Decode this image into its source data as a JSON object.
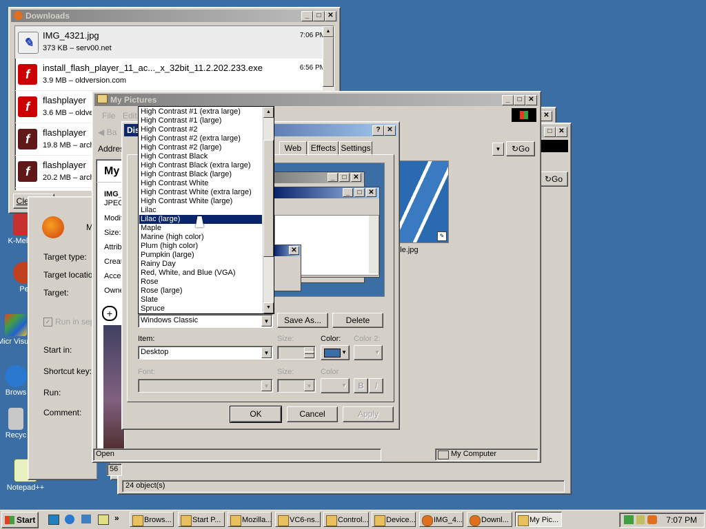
{
  "colors": {
    "desktop": "#3a6ea5",
    "titlebar_active": "#0a246a",
    "selection": "#0a246a",
    "window_face": "#d4d0c8"
  },
  "desktop_icons": [
    {
      "label": "K-Meleon",
      "icon": "k-meleon-icon"
    },
    {
      "label": "Pe",
      "icon": "app-icon"
    },
    {
      "label": "Micr Visual",
      "icon": "visual-studio-icon"
    },
    {
      "label": "Brows",
      "icon": "browser-icon"
    },
    {
      "label": "Recyc",
      "icon": "recycle-bin-icon"
    },
    {
      "label": "Notepad++",
      "icon": "notepad-plus-plus-icon"
    }
  ],
  "downloads": {
    "title": "Downloads",
    "items": [
      {
        "name": "IMG_4321.jpg",
        "info": "373 KB – serv00.net",
        "time": "7:06 PM"
      },
      {
        "name": "install_flash_player_11_ac..._x_32bit_11.2.202.233.exe",
        "info": "3.9 MB – oldversion.com",
        "time": "6:56 PM"
      },
      {
        "name": "flashplayer",
        "info": "3.6 MB – oldve",
        "time": ""
      },
      {
        "name": "flashplayer",
        "info": "19.8 MB – arch",
        "time": ""
      },
      {
        "name": "flashplayer",
        "info": "20.2 MB – arch",
        "time": ""
      }
    ],
    "clear_list": "Clear List"
  },
  "shortcut_props": {
    "title_partial": "M",
    "labels": {
      "target_type": "Target type:",
      "target_location": "Target location",
      "target": "Target:",
      "run_in_sep": "Run in sep",
      "start_in": "Start in:",
      "shortcut_key": "Shortcut key:",
      "run": "Run:",
      "comment": "Comment:"
    },
    "status_num": "56"
  },
  "my_pictures": {
    "title": "My Pictures",
    "menu": {
      "file": "File",
      "edit": "Edit"
    },
    "back_label": "Ba",
    "address_label": "Addres",
    "go": "Go",
    "panel_title": "My",
    "file_title": "IMG_",
    "file_type": "JPEG",
    "attr_labels": [
      "Modif",
      "Size:",
      "Attrib",
      "Creat",
      "Acce",
      "Owne"
    ],
    "thumb_caption": "mple.jpg",
    "status_left": "Open",
    "status_right": "My Computer"
  },
  "back_window": {
    "go": "Go",
    "status": "24 object(s)"
  },
  "display": {
    "title_partial": "Dis",
    "tabs": [
      "Web",
      "Effects",
      "Settings"
    ],
    "scheme_list": [
      "High Contrast #1 (extra large)",
      "High Contrast #1 (large)",
      "High Contrast #2",
      "High Contrast #2 (extra large)",
      "High Contrast #2 (large)",
      "High Contrast Black",
      "High Contrast Black (extra large)",
      "High Contrast Black (large)",
      "High Contrast White",
      "High Contrast White (extra large)",
      "High Contrast White (large)",
      "Lilac",
      "Lilac (large)",
      "Maple",
      "Marine (high color)",
      "Plum (high color)",
      "Pumpkin (large)",
      "Rainy Day",
      "Red, White, and Blue (VGA)",
      "Rose",
      "Rose (large)",
      "Slate",
      "Spruce"
    ],
    "selected_index": 12,
    "scheme_value": "Windows Classic",
    "save_as": "Save As...",
    "delete": "Delete",
    "item_label": "Item:",
    "item_value": "Desktop",
    "size_label": "Size:",
    "color_label": "Color:",
    "color2_label": "Color 2:",
    "font_label": "Font:",
    "font_size_label": "Size:",
    "font_color_label": "Color",
    "bold": "B",
    "italic": "I",
    "ok": "OK",
    "cancel": "Cancel",
    "apply": "Apply"
  },
  "taskbar": {
    "start": "Start",
    "tasks": [
      "Brows...",
      "Start P...",
      "Mozilla...",
      "VC6-ns...",
      "Control...",
      "Device...",
      "IMG_4...",
      "Downl...",
      "My Pic..."
    ],
    "clock": "7:07 PM"
  }
}
